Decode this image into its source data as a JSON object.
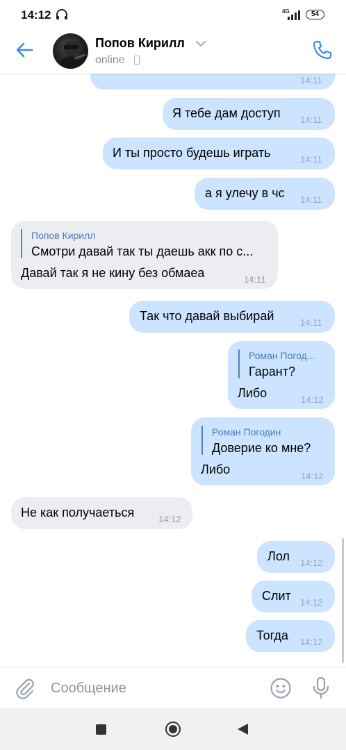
{
  "status_bar": {
    "time": "14:12",
    "network": "4G",
    "battery": "54"
  },
  "header": {
    "name": "Попов Кирилл",
    "status": "online"
  },
  "messages": [
    {
      "dir": "out",
      "text": "",
      "time": "14:11"
    },
    {
      "dir": "out",
      "text": "Я тебе дам доступ",
      "time": "14:11"
    },
    {
      "dir": "out",
      "text": "И ты просто будешь играть",
      "time": "14:11"
    },
    {
      "dir": "out",
      "text": "а я улечу в чс",
      "time": "14:11"
    },
    {
      "dir": "in",
      "quote_author": "Попов Кирилл",
      "quote_text": "Смотри давай так ты даешь акк по с...",
      "text": "Давай так я не кину без обмаеа",
      "time": "14:11"
    },
    {
      "dir": "out",
      "text": "Так что давай выбирай",
      "time": "14:11"
    },
    {
      "dir": "out",
      "quote_author": "Роман Погод...",
      "quote_text": "Гарант?",
      "text": "Либо",
      "time": "14:12"
    },
    {
      "dir": "out",
      "quote_author": "Роман Погодин",
      "quote_text": "Доверие ко мне?",
      "text": "Либо",
      "time": "14:12"
    },
    {
      "dir": "in",
      "text": "Не как получаеться",
      "time": "14:12"
    },
    {
      "dir": "out",
      "text": "Лол",
      "time": "14:12"
    },
    {
      "dir": "out",
      "text": "Слит",
      "time": "14:12"
    },
    {
      "dir": "out",
      "text": "Тогда",
      "time": "14:12"
    }
  ],
  "input": {
    "placeholder": "Сообщение"
  },
  "colors": {
    "accent": "#3f8ae0",
    "outgoing_bubble": "#cce4ff",
    "incoming_bubble": "#ebedf0"
  },
  "icons": [
    "headphones-icon",
    "signal-icon",
    "battery-icon",
    "back-arrow-icon",
    "chevron-down-icon",
    "phone-icon",
    "paperclip-icon",
    "smile-icon",
    "mic-icon",
    "nav-square-icon",
    "nav-home-icon",
    "nav-back-icon"
  ]
}
